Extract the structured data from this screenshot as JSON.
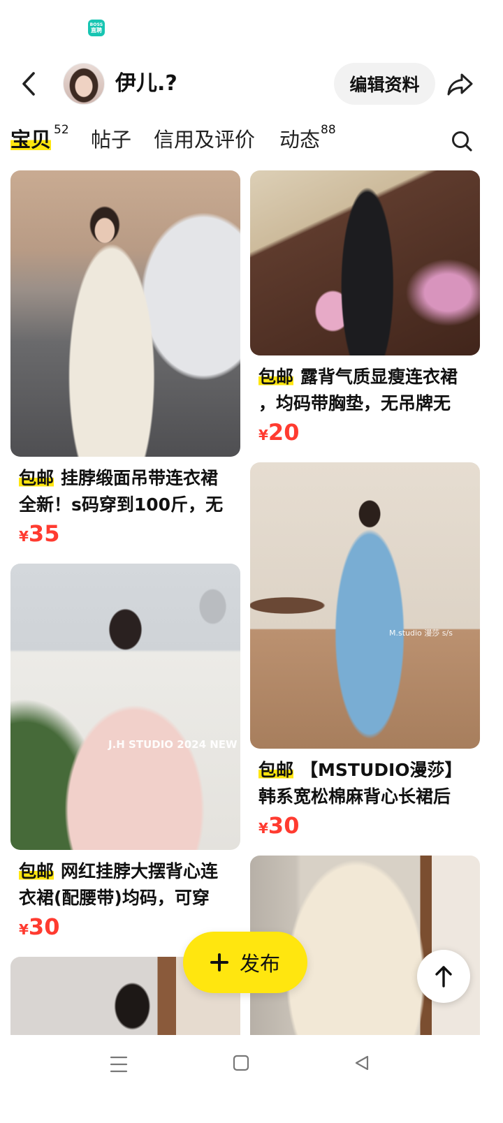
{
  "status_bar": {
    "app_badge_top": "BOSS",
    "app_badge_bottom": "直聘",
    "app_badge_color": "#17c5b2"
  },
  "header": {
    "back_icon": "chevron-left-icon",
    "username": "伊儿.?",
    "edit_profile_label": "编辑资料",
    "share_icon": "share-icon"
  },
  "tabs": [
    {
      "label": "宝贝",
      "count": "52",
      "active": true
    },
    {
      "label": "帖子",
      "active": false
    },
    {
      "label": "信用及评价",
      "active": false
    },
    {
      "label": "动态",
      "count": "88",
      "active": false
    }
  ],
  "search_icon": "search-icon",
  "listings": {
    "left": [
      {
        "tag": "包邮",
        "title_line1": "挂脖缎面吊带连衣裙",
        "title_line2": "全新！s码穿到100斤，无",
        "currency": "¥",
        "price": "35"
      },
      {
        "tag": "包邮",
        "title_line1": "网红挂脖大摆背心连",
        "title_line2": "衣裙(配腰带)均码，可穿",
        "currency": "¥",
        "price": "30",
        "photo_watermark": "J.H STUDIO 2024 NEW"
      }
    ],
    "right": [
      {
        "tag": "包邮",
        "title_line1": "露背气质显瘦连衣裙",
        "title_line2": "，均码带胸垫，无吊牌无",
        "currency": "¥",
        "price": "20"
      },
      {
        "tag": "包邮",
        "title_line1": "【MSTUDIO漫莎】",
        "title_line2": "韩系宽松棉麻背心长裙后",
        "currency": "¥",
        "price": "30",
        "photo_watermark": "M.studio 漫莎 s/s"
      }
    ]
  },
  "publish_button": {
    "icon": "plus-icon",
    "label": "发布"
  },
  "scroll_top_button": {
    "icon": "arrow-up-icon"
  },
  "system_nav": {
    "icons": [
      "menu-icon",
      "home-icon",
      "back-icon"
    ]
  },
  "colors": {
    "accent_yellow": "#ffe60f",
    "price_red": "#ff3b30",
    "text": "#111111",
    "pill_gray": "#f2f2f2"
  }
}
